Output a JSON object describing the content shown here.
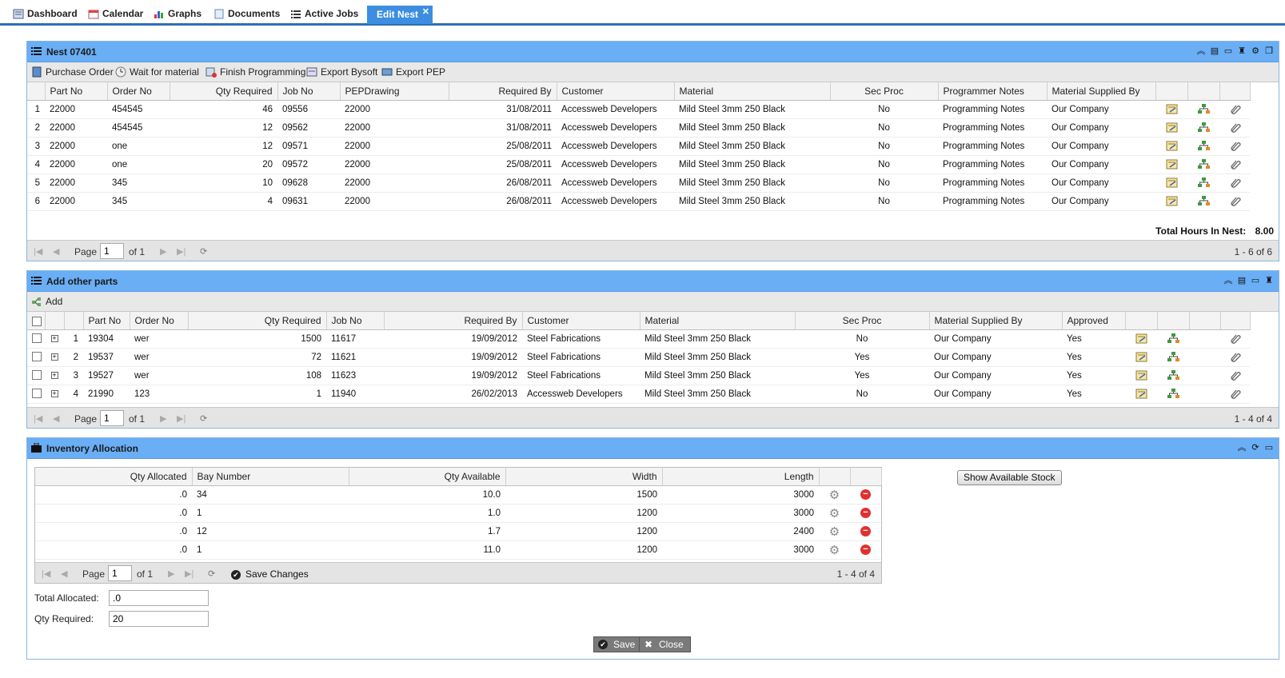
{
  "tabs": [
    {
      "label": "Dashboard",
      "icon": "dashboard-icon"
    },
    {
      "label": "Calendar",
      "icon": "calendar-icon"
    },
    {
      "label": "Graphs",
      "icon": "graphs-icon"
    },
    {
      "label": "Documents",
      "icon": "documents-icon"
    },
    {
      "label": "Active Jobs",
      "icon": "list-icon"
    },
    {
      "label": "Edit Nest",
      "icon": "close-icon"
    }
  ],
  "nest": {
    "title": "Nest 07401",
    "toolbar": [
      "Purchase Order",
      "Wait for material",
      "Finish Programming",
      "Export Bysoft",
      "Export PEP"
    ],
    "columns": [
      "Part No",
      "Order No",
      "Qty Required",
      "Job No",
      "PEPDrawing",
      "Required By",
      "Customer",
      "Material",
      "Sec Proc",
      "Programmer Notes",
      "Material Supplied By"
    ],
    "rows": [
      [
        "1",
        "22000",
        "454545",
        "46",
        "09556",
        "22000",
        "31/08/2011",
        "Accessweb Developers",
        "Mild Steel 3mm 250 Black",
        "No",
        "Programming Notes",
        "Our Company"
      ],
      [
        "2",
        "22000",
        "454545",
        "12",
        "09562",
        "22000",
        "31/08/2011",
        "Accessweb Developers",
        "Mild Steel 3mm 250 Black",
        "No",
        "Programming Notes",
        "Our Company"
      ],
      [
        "3",
        "22000",
        "one",
        "12",
        "09571",
        "22000",
        "25/08/2011",
        "Accessweb Developers",
        "Mild Steel 3mm 250 Black",
        "No",
        "Programming Notes",
        "Our Company"
      ],
      [
        "4",
        "22000",
        "one",
        "20",
        "09572",
        "22000",
        "25/08/2011",
        "Accessweb Developers",
        "Mild Steel 3mm 250 Black",
        "No",
        "Programming Notes",
        "Our Company"
      ],
      [
        "5",
        "22000",
        "345",
        "10",
        "09628",
        "22000",
        "26/08/2011",
        "Accessweb Developers",
        "Mild Steel 3mm 250 Black",
        "No",
        "Programming Notes",
        "Our Company"
      ],
      [
        "6",
        "22000",
        "345",
        "4",
        "09631",
        "22000",
        "26/08/2011",
        "Accessweb Developers",
        "Mild Steel 3mm 250 Black",
        "No",
        "Programming Notes",
        "Our Company"
      ]
    ],
    "total_label": "Total Hours In Nest:",
    "total_value": "8.00",
    "pager": {
      "page_label": "Page",
      "page": "1",
      "of": "of 1",
      "count": "1 - 6 of 6"
    }
  },
  "other": {
    "title": "Add other parts",
    "add_label": "Add",
    "columns": [
      "Part No",
      "Order No",
      "Qty Required",
      "Job No",
      "Required By",
      "Customer",
      "Material",
      "Sec Proc",
      "Material Supplied By",
      "Approved"
    ],
    "rows": [
      [
        "1",
        "19304",
        "wer",
        "1500",
        "11617",
        "19/09/2012",
        "Steel Fabrications",
        "Mild Steel 3mm 250 Black",
        "No",
        "Our Company",
        "Yes"
      ],
      [
        "2",
        "19537",
        "wer",
        "72",
        "11621",
        "19/09/2012",
        "Steel Fabrications",
        "Mild Steel 3mm 250 Black",
        "Yes",
        "Our Company",
        "Yes"
      ],
      [
        "3",
        "19527",
        "wer",
        "108",
        "11623",
        "19/09/2012",
        "Steel Fabrications",
        "Mild Steel 3mm 250 Black",
        "Yes",
        "Our Company",
        "Yes"
      ],
      [
        "4",
        "21990",
        "123",
        "1",
        "11940",
        "26/02/2013",
        "Accessweb Developers",
        "Mild Steel 3mm 250 Black",
        "No",
        "Our Company",
        "Yes"
      ]
    ],
    "pager": {
      "page_label": "Page",
      "page": "1",
      "of": "of 1",
      "count": "1 - 4 of 4"
    }
  },
  "inventory": {
    "title": "Inventory Allocation",
    "columns": [
      "Qty Allocated",
      "Bay Number",
      "Qty Available",
      "Width",
      "Length"
    ],
    "rows": [
      [
        ".0",
        "34",
        "10.0",
        "1500",
        "3000"
      ],
      [
        ".0",
        "1",
        "1.0",
        "1200",
        "3000"
      ],
      [
        ".0",
        "12",
        "1.7",
        "1200",
        "2400"
      ],
      [
        ".0",
        "1",
        "11.0",
        "1200",
        "3000"
      ]
    ],
    "pager": {
      "page_label": "Page",
      "page": "1",
      "of": "of 1",
      "save_changes": "Save Changes",
      "count": "1 - 4 of 4"
    },
    "show_stock": "Show Available Stock",
    "total_allocated_label": "Total Allocated:",
    "total_allocated": ".0",
    "qty_required_label": "Qty Required:",
    "qty_required": "20",
    "save": "Save",
    "close": "Close"
  },
  "colors": {
    "header_blue": "#6aaef5",
    "tab_active": "#3d8ee0",
    "accent": "#2f6fb5"
  }
}
